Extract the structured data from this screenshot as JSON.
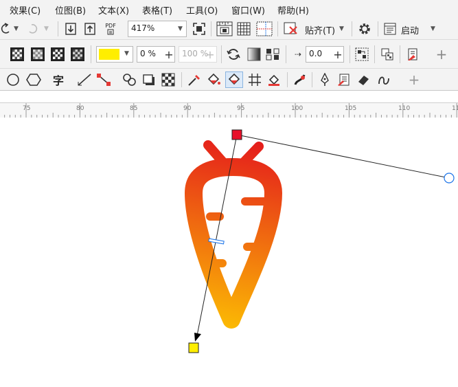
{
  "menu": {
    "effects": "效果(C)",
    "bitmaps": "位图(B)",
    "text": "文本(X)",
    "table": "表格(T)",
    "tools": "工具(O)",
    "window": "窗口(W)",
    "help": "帮助(H)"
  },
  "standard_toolbar": {
    "pdf_label": "PDF",
    "zoom_value": "417%",
    "snap_label": "贴齐(T)",
    "launch_label": "启动"
  },
  "property_bar": {
    "fill_color": "#ffee00",
    "transparency_value": "0 %",
    "disabled_percent": "100 %",
    "angle_value": "0.0"
  },
  "toolbox": {
    "text_tool_glyph": "字"
  },
  "ruler": {
    "marks": [
      "75",
      "80",
      "85",
      "90",
      "95",
      "100",
      "105",
      "110",
      "11"
    ]
  },
  "gradient": {
    "start_color": "#e41a1c",
    "end_color": "#ffd000",
    "handle_start_color": "#e8102a",
    "handle_end_color": "#ffee00"
  }
}
